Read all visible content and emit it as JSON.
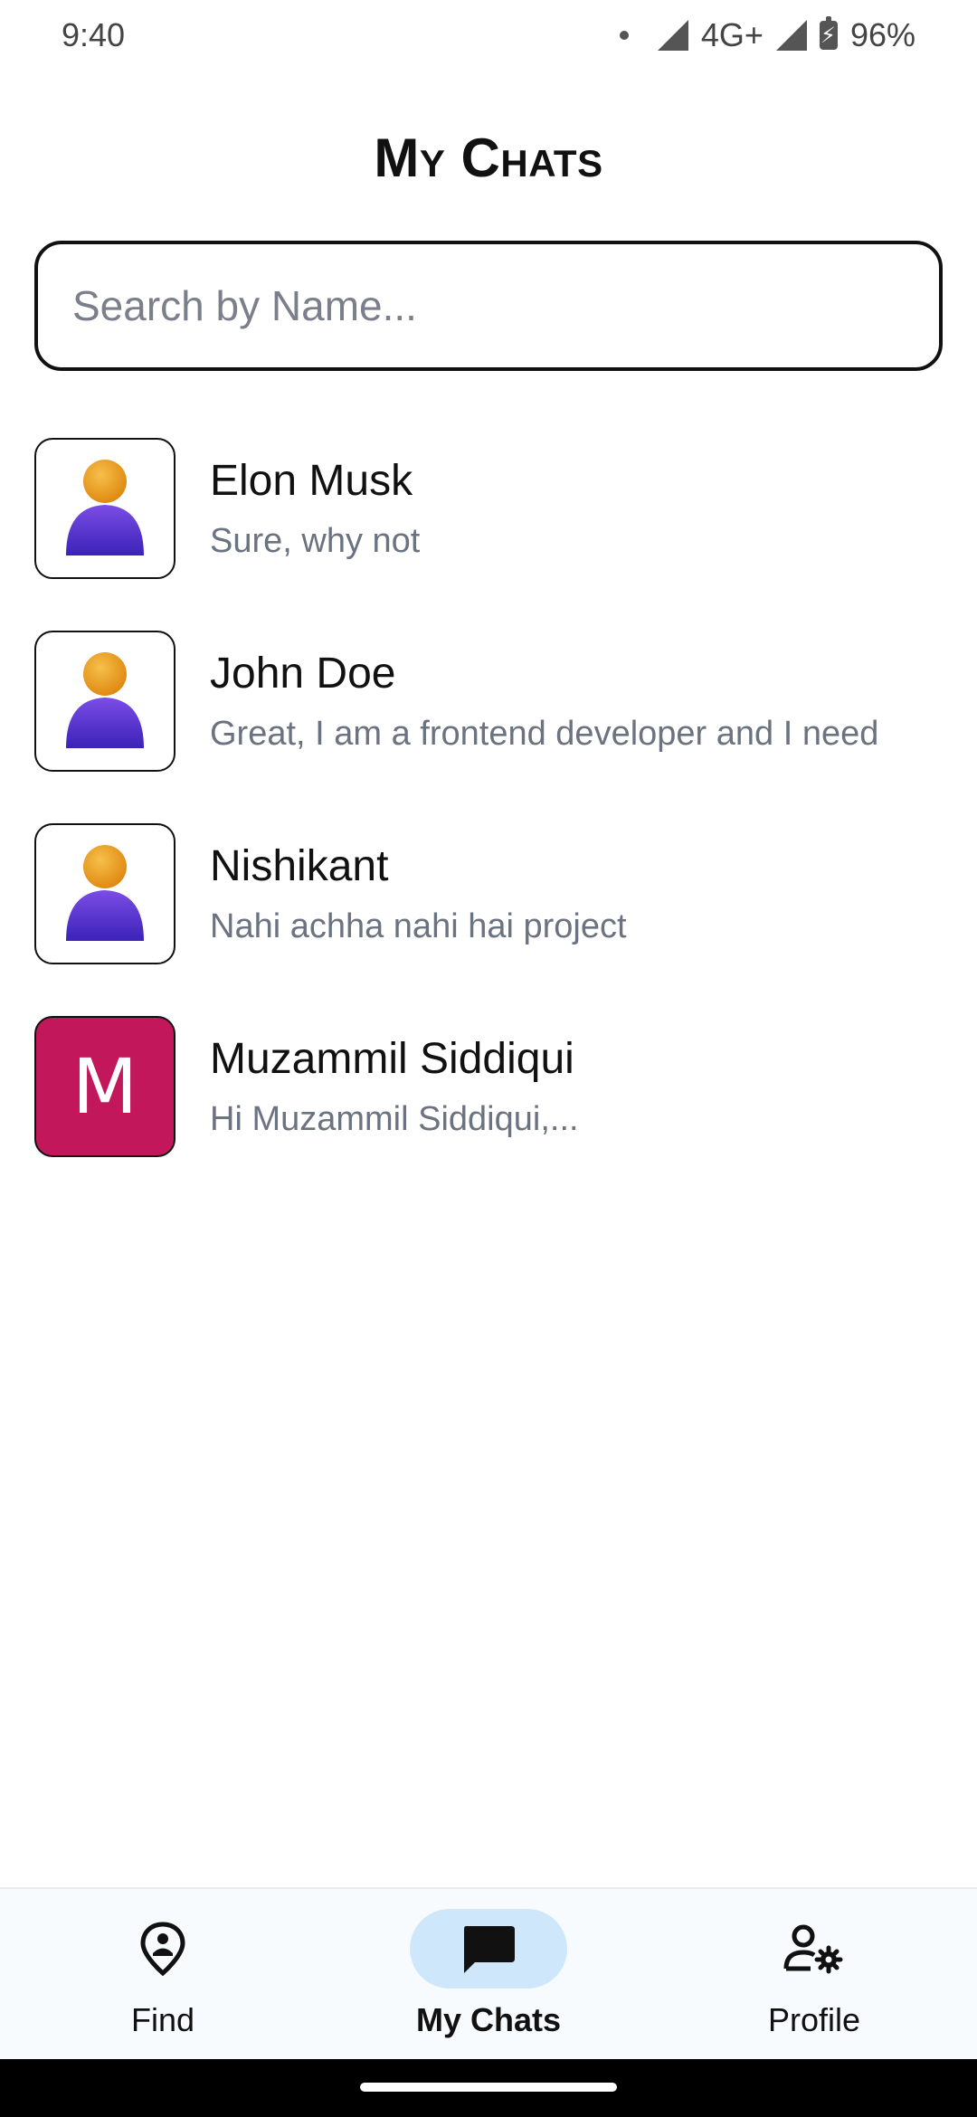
{
  "status_bar": {
    "time": "9:40",
    "network": "4G+",
    "battery": "96%"
  },
  "page": {
    "title": "My Chats"
  },
  "search": {
    "placeholder": "Search by Name..."
  },
  "chats": [
    {
      "name": "Elon Musk",
      "preview": "Sure, why not",
      "avatar": "person-icon"
    },
    {
      "name": "John Doe",
      "preview": "Great, I am a frontend developer and I need",
      "avatar": "person-icon"
    },
    {
      "name": "Nishikant",
      "preview": "Nahi achha nahi hai project",
      "avatar": "person-icon"
    },
    {
      "name": "Muzammil Siddiqui",
      "preview": "Hi Muzammil Siddiqui,...",
      "avatar_letter": "M",
      "avatar_color": "#c2185b"
    }
  ],
  "bottom_nav": {
    "items": [
      {
        "label": "Find",
        "icon": "location-person-icon",
        "active": false
      },
      {
        "label": "My Chats",
        "icon": "chat-bubble-icon",
        "active": true
      },
      {
        "label": "Profile",
        "icon": "profile-settings-icon",
        "active": false
      }
    ]
  },
  "colors": {
    "accent_pill": "#cfe7fb",
    "avatar_letter_bg": "#c2185b",
    "nav_bg": "#f7fbfe"
  }
}
